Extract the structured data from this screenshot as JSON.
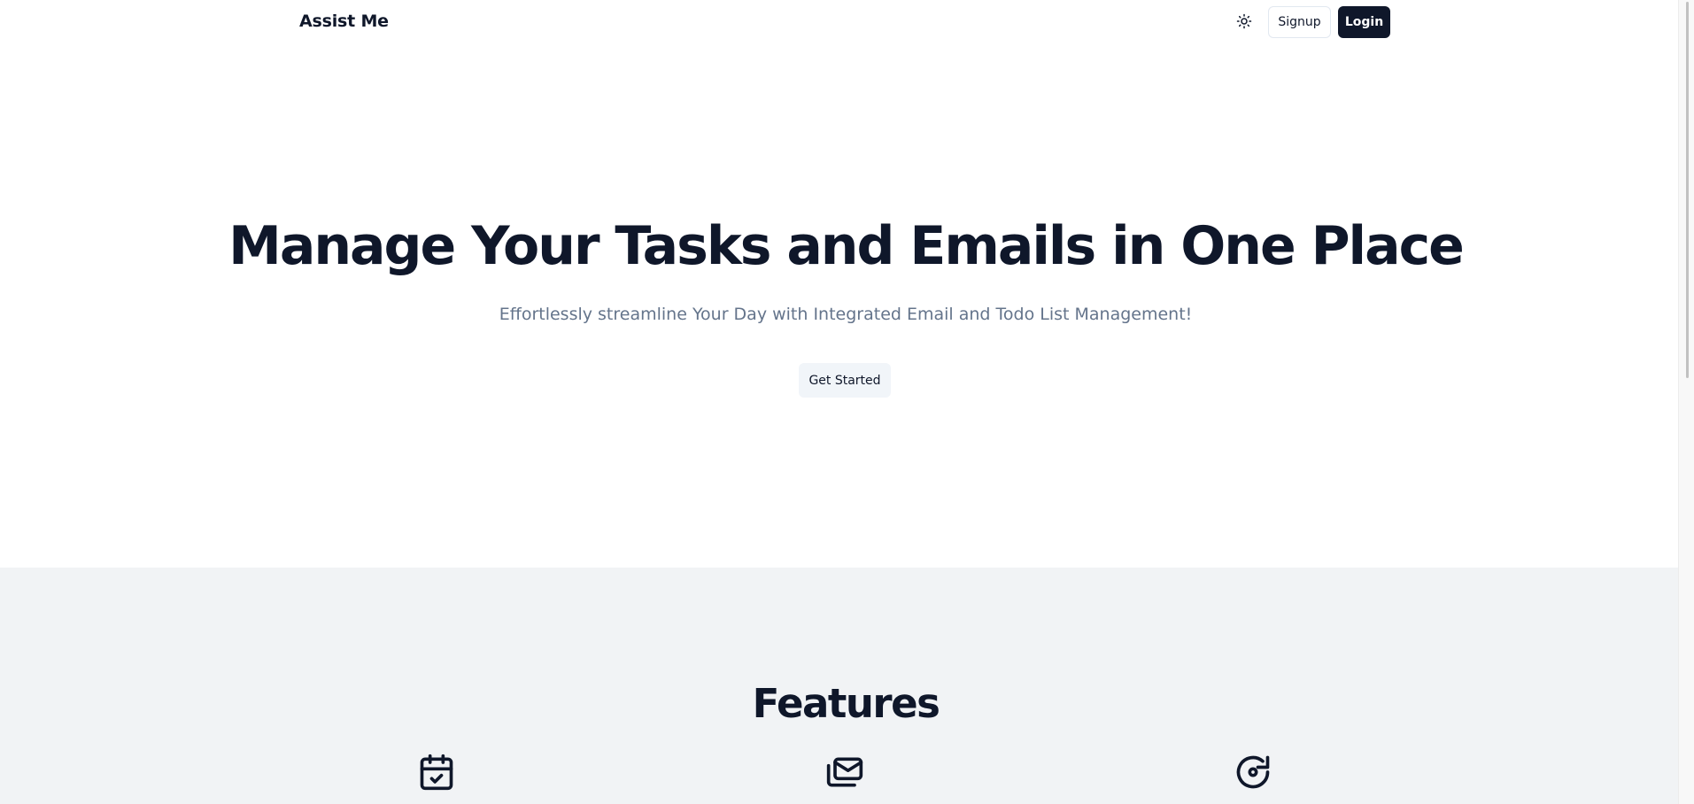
{
  "header": {
    "brand": "Assist Me",
    "theme_toggle_icon": "sun-icon",
    "signup_label": "Signup",
    "login_label": "Login"
  },
  "hero": {
    "title": "Manage Your Tasks and Emails in One Place",
    "subtitle": "Effortlessly streamline Your Day with Integrated Email and Todo List Management!",
    "cta_label": "Get Started"
  },
  "features": {
    "title": "Features",
    "items": [
      {
        "icon": "calendar-check-icon"
      },
      {
        "icon": "mail-stack-icon"
      },
      {
        "icon": "refresh-cycle-icon"
      }
    ]
  },
  "colors": {
    "primary": "#0f172a",
    "muted_text": "#64748b",
    "secondary_bg": "#f1f5f9",
    "features_bg": "#f1f3f5",
    "border": "#e2e8f0"
  }
}
